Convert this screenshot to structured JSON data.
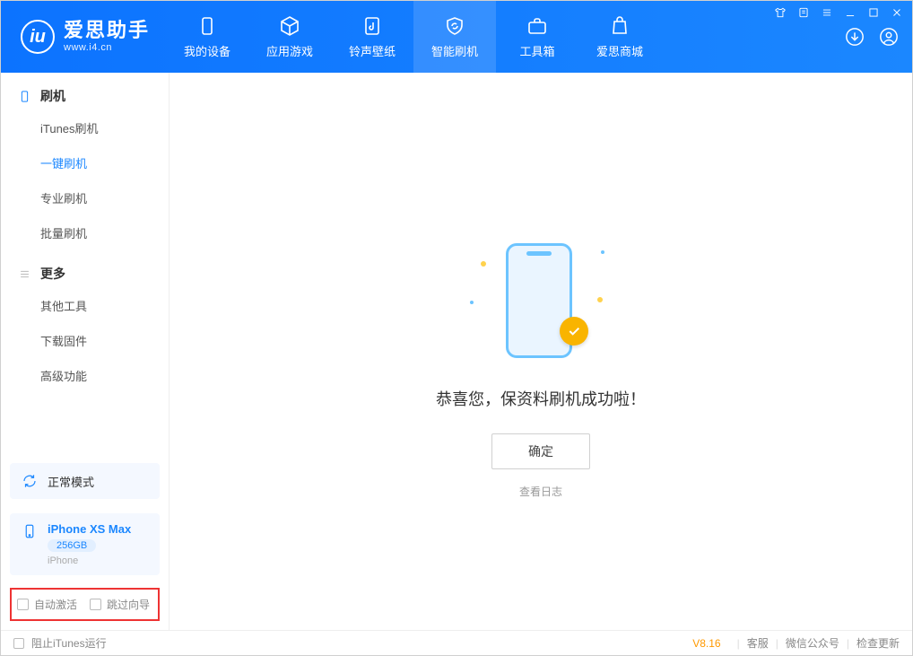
{
  "header": {
    "app_name": "爱思助手",
    "app_domain": "www.i4.cn",
    "nav": [
      {
        "label": "我的设备"
      },
      {
        "label": "应用游戏"
      },
      {
        "label": "铃声壁纸"
      },
      {
        "label": "智能刷机"
      },
      {
        "label": "工具箱"
      },
      {
        "label": "爱思商城"
      }
    ]
  },
  "sidebar": {
    "section1_title": "刷机",
    "section1_items": [
      {
        "label": "iTunes刷机",
        "active": false
      },
      {
        "label": "一键刷机",
        "active": true
      },
      {
        "label": "专业刷机",
        "active": false
      },
      {
        "label": "批量刷机",
        "active": false
      }
    ],
    "section2_title": "更多",
    "section2_items": [
      {
        "label": "其他工具"
      },
      {
        "label": "下载固件"
      },
      {
        "label": "高级功能"
      }
    ],
    "mode_label": "正常模式",
    "device": {
      "name": "iPhone XS Max",
      "capacity": "256GB",
      "type": "iPhone"
    },
    "check1": "自动激活",
    "check2": "跳过向导"
  },
  "content": {
    "success_msg": "恭喜您，保资料刷机成功啦！",
    "ok_btn": "确定",
    "view_log": "查看日志"
  },
  "statusbar": {
    "stop_itunes": "阻止iTunes运行",
    "version": "V8.16",
    "link1": "客服",
    "link2": "微信公众号",
    "link3": "检查更新"
  }
}
